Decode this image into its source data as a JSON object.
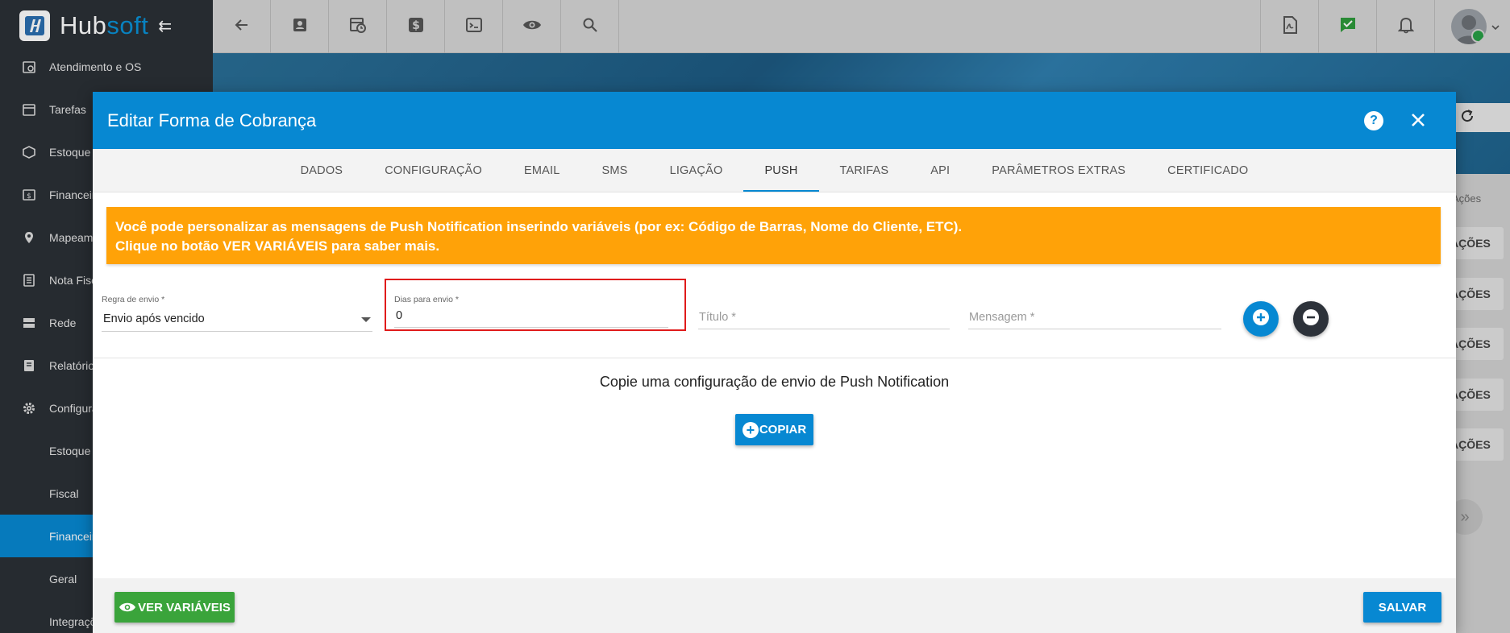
{
  "app": {
    "logo_hub": "Hub",
    "logo_soft": "soft"
  },
  "sidebar": {
    "items": [
      {
        "label": "Atendimento e OS",
        "icon": "calendar-clock-icon"
      },
      {
        "label": "Tarefas",
        "icon": "calendar-icon"
      },
      {
        "label": "Estoque",
        "icon": "box-icon"
      },
      {
        "label": "Financeiro",
        "icon": "money-icon"
      },
      {
        "label": "Mapeamento",
        "icon": "map-pin-icon"
      },
      {
        "label": "Nota Fiscal",
        "icon": "document-icon"
      },
      {
        "label": "Rede",
        "icon": "network-icon"
      },
      {
        "label": "Relatórios",
        "icon": "report-icon"
      },
      {
        "label": "Configurações",
        "icon": "gear-icon"
      }
    ],
    "sub_items": [
      {
        "label": "Estoque"
      },
      {
        "label": "Fiscal"
      },
      {
        "label": "Financeiro",
        "active": true
      },
      {
        "label": "Geral"
      },
      {
        "label": "Integrações"
      }
    ]
  },
  "background": {
    "col_header": "Ações",
    "action_label": "AÇÕES"
  },
  "modal": {
    "title": "Editar Forma de Cobrança",
    "tabs": [
      {
        "label": "DADOS"
      },
      {
        "label": "CONFIGURAÇÃO"
      },
      {
        "label": "EMAIL"
      },
      {
        "label": "SMS"
      },
      {
        "label": "LIGAÇÃO"
      },
      {
        "label": "PUSH",
        "active": true
      },
      {
        "label": "TARIFAS"
      },
      {
        "label": "API"
      },
      {
        "label": "PARÂMETROS EXTRAS"
      },
      {
        "label": "CERTIFICADO"
      }
    ],
    "alert": {
      "line1": "Você pode personalizar as mensagens de Push Notification inserindo variáveis (por ex: Código de Barras, Nome do Cliente, ETC).",
      "line2": "Clique no botão VER VARIÁVEIS para saber mais."
    },
    "form": {
      "regra_label": "Regra de envio *",
      "regra_value": "Envio após vencido",
      "dias_label": "Dias para envio *",
      "dias_value": "0",
      "titulo_placeholder": "Título *",
      "mensagem_placeholder": "Mensagem *"
    },
    "copy": {
      "text": "Copie uma configuração de envio de Push Notification",
      "button": "COPIAR"
    },
    "footer": {
      "ver_variaveis": "VER VARIÁVEIS",
      "salvar": "SALVAR"
    }
  },
  "colors": {
    "primary": "#0788d2",
    "alert": "#ffa208",
    "success": "#3aa43b",
    "sidebar": "#2b3036",
    "highlight_border": "#e01b1b"
  }
}
